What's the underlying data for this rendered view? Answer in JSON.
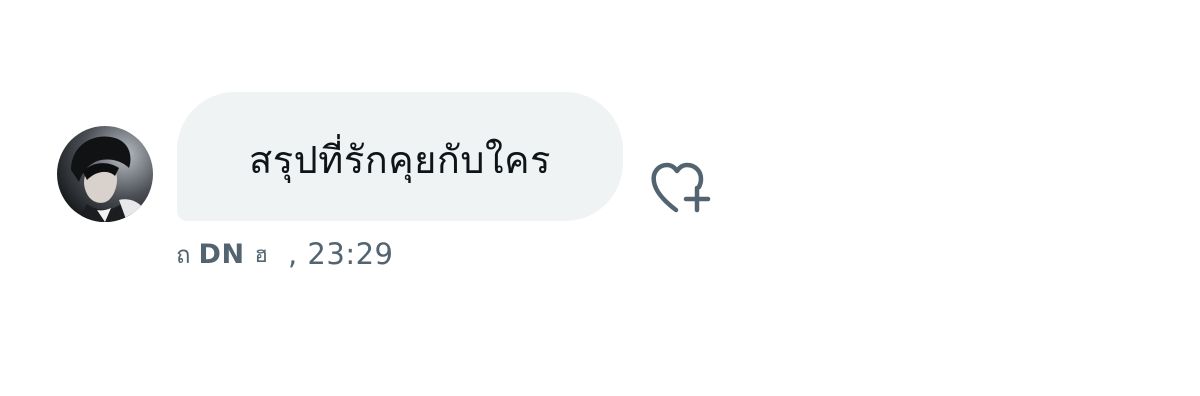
{
  "message": {
    "text": "สรุปที่รักคุยกับใคร",
    "bubble_color": "#eff3f4",
    "text_color": "#0f1419"
  },
  "meta": {
    "prefix_glyph": "ถ",
    "sender": "DN",
    "suffix_glyph": "ฮ",
    "time": ", 23:29",
    "color": "#536471"
  },
  "icons": {
    "avatar": "user-avatar",
    "reaction": "heart-plus-icon"
  }
}
